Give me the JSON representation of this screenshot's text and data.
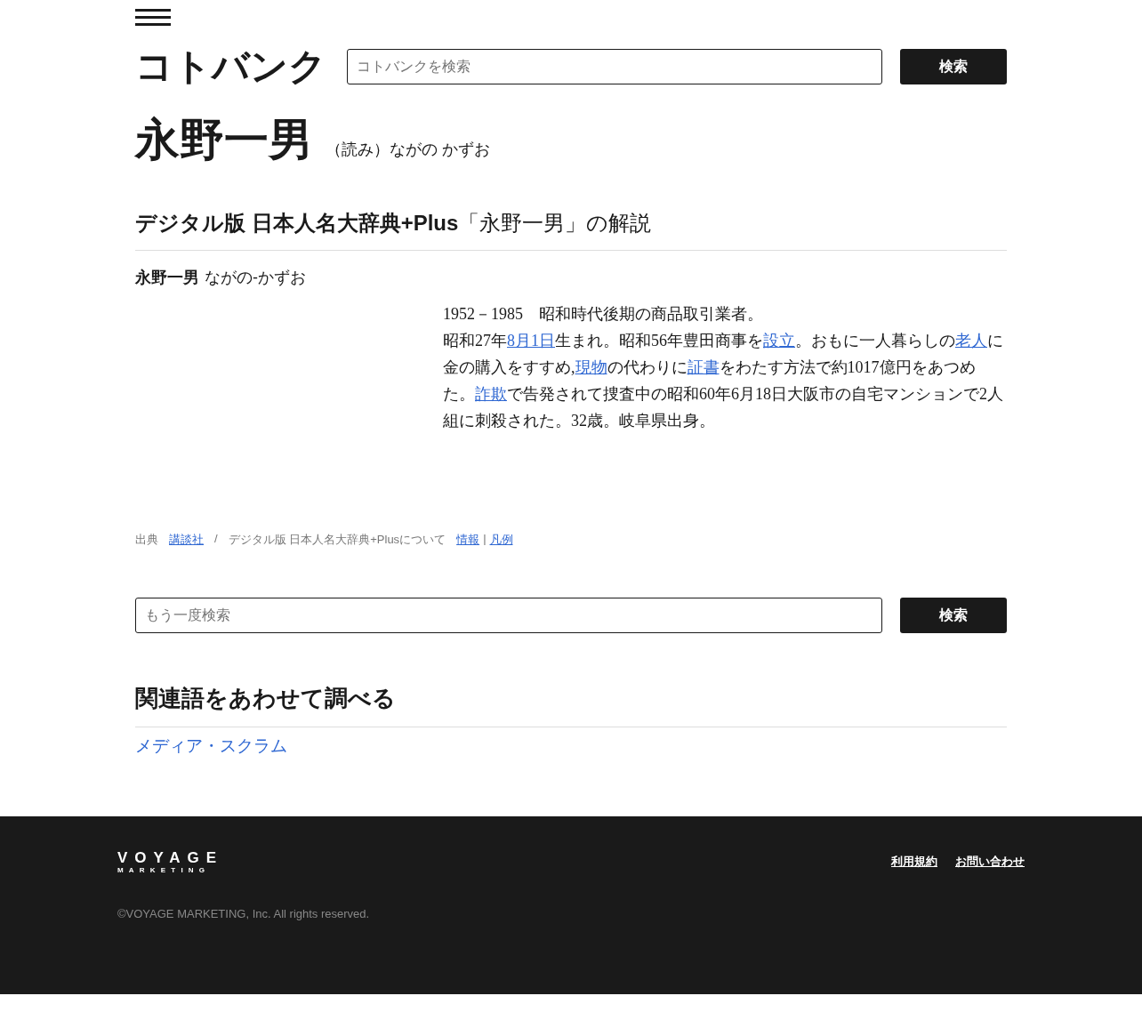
{
  "header": {
    "logo": "コトバンク",
    "search": {
      "placeholder": "コトバンクを検索"
    },
    "search_button": "検索"
  },
  "entry": {
    "title": "永野一男",
    "reading": "（読み）ながの かずお"
  },
  "section": {
    "heading_bold": "デジタル版 日本人名大辞典+Plus",
    "heading_rest": "「永野一男」の解説",
    "term": "永野一男",
    "term_reading": "ながの-かずお",
    "paragraphs": [
      [
        {
          "text": "1952－1985　昭和時代後期の商品取引業者。",
          "link": false
        }
      ],
      [
        {
          "text": "昭和27年",
          "link": false
        },
        {
          "text": "8月1日",
          "link": true
        },
        {
          "text": "生まれ。昭和56年豊田商事を",
          "link": false
        },
        {
          "text": "設立",
          "link": true
        },
        {
          "text": "。おもに一人暮らしの",
          "link": false
        },
        {
          "text": "老人",
          "link": true
        },
        {
          "text": "に金の購入をすすめ,",
          "link": false
        },
        {
          "text": "現物",
          "link": true
        },
        {
          "text": "の代わりに",
          "link": false
        },
        {
          "text": "証書",
          "link": true
        },
        {
          "text": "をわたす方法で約1017億円をあつめた。",
          "link": false
        },
        {
          "text": "詐欺",
          "link": true
        },
        {
          "text": "で告発されて捜査中の昭和60年6月18日大阪市の自宅マンションで2人組に刺殺された。32歳。岐阜県出身。",
          "link": false
        }
      ]
    ],
    "source": {
      "label": "出典",
      "publisher": "講談社",
      "separator": "/",
      "about": "デジタル版 日本人名大辞典+Plusについて",
      "info": "情報",
      "divider": "|",
      "legend": "凡例"
    }
  },
  "search_again": {
    "placeholder": "もう一度検索",
    "button": "検索"
  },
  "related": {
    "heading": "関連語をあわせて調べる",
    "items": [
      "メディア・スクラム"
    ]
  },
  "footer": {
    "logo_top": "VOYAGE",
    "logo_bottom": "MARKETING",
    "links": [
      "利用規約",
      "お問い合わせ"
    ],
    "copyright": "©VOYAGE MARKETING, Inc. All rights reserved."
  }
}
